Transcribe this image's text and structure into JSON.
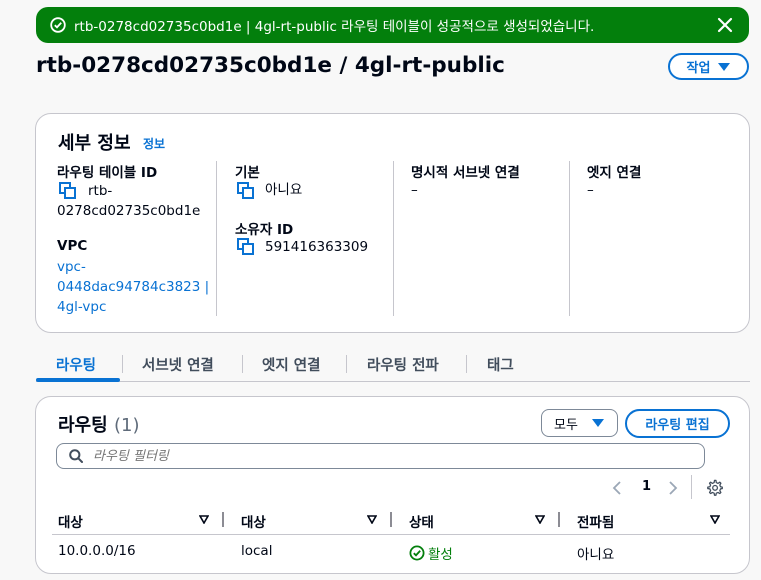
{
  "flash": {
    "message": "rtb-0278cd02735c0bd1e | 4gl-rt-public 라우팅 테이블이 성공적으로 생성되었습니다.",
    "icon": "check-circle-icon",
    "close_icon": "close-icon",
    "color": "#037f0c"
  },
  "header": {
    "title": "rtb-0278cd02735c0bd1e / 4gl-rt-public",
    "actions_label": "작업"
  },
  "details": {
    "heading": "세부 정보",
    "info_link": "정보",
    "route_table_id_label": "라우팅 테이블 ID",
    "route_table_id_line1": "rtb-",
    "route_table_id_line2": "0278cd02735c0bd1e",
    "vpc_label": "VPC",
    "vpc_line1": "vpc-",
    "vpc_line2": "0448dac94784c3823 |",
    "vpc_line3": "4gl-vpc",
    "main_label": "기본",
    "main_value": "아니요",
    "owner_label": "소유자 ID",
    "owner_value": "591416363309",
    "explicit_subnet_label": "명시적 서브넷 연결",
    "explicit_subnet_value": "–",
    "edge_label": "엣지 연결",
    "edge_value": "–"
  },
  "tabs": [
    "라우팅",
    "서브넷 연결",
    "엣지 연결",
    "라우팅 전파",
    "태그"
  ],
  "routes": {
    "heading": "라우팅",
    "count": "(1)",
    "filter_select": "모두",
    "edit_button": "라우팅 편집",
    "search_placeholder": "라우팅 필터링",
    "page": "1",
    "columns": [
      "대상",
      "대상",
      "상태",
      "전파됨"
    ],
    "rows": [
      {
        "destination": "10.0.0.0/16",
        "target": "local",
        "status": "활성",
        "propagated": "아니요"
      }
    ]
  },
  "colors": {
    "accent": "#0972d3",
    "success": "#037f0c"
  }
}
